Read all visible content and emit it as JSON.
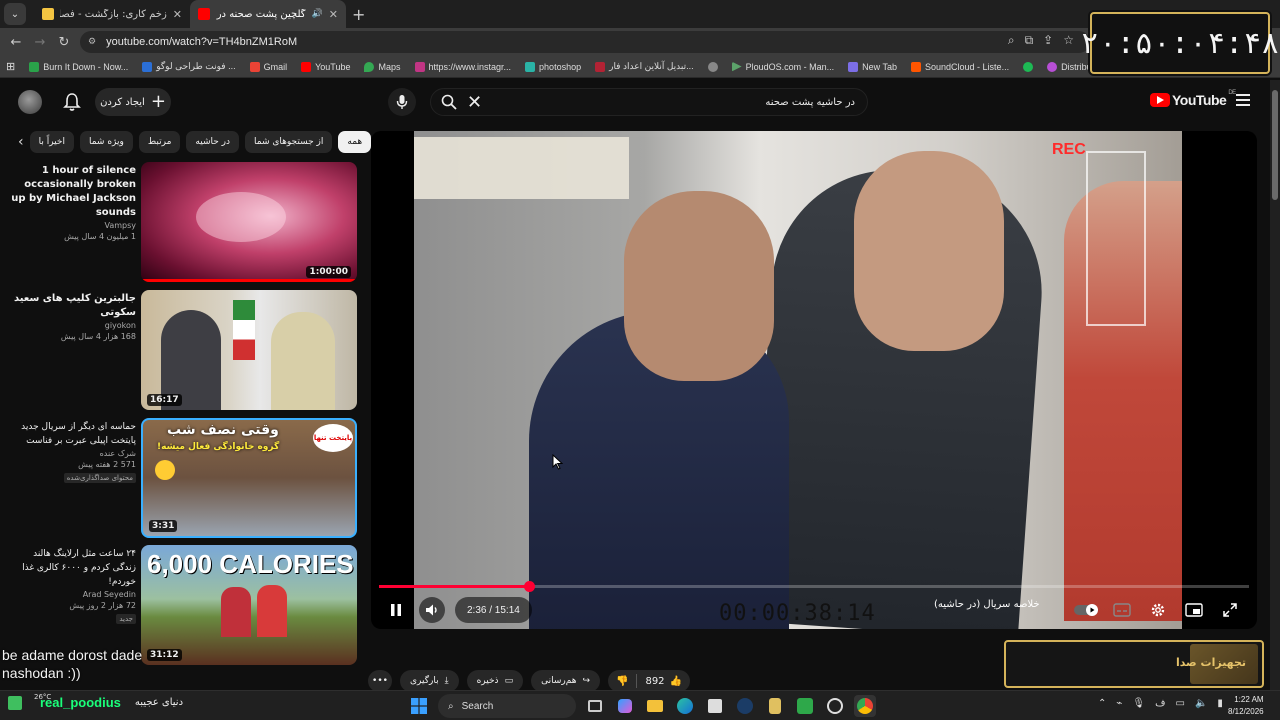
{
  "browser": {
    "tabs": [
      {
        "title": "زخم کاری: بازگشت - فصل 2 قسم...",
        "favicon_color": "#f4c542",
        "active": false
      },
      {
        "title": "گلچین پشت صحنه در حاشیه",
        "favicon_color": "#ff0000",
        "active": true
      }
    ],
    "url": "youtube.com/watch?v=TH4bnZM1RoM",
    "bookmarks": [
      {
        "label": "Burn It Down - Now...",
        "color": "#2aa24a"
      },
      {
        "label": "فونت طراحی لوگو ...",
        "color": "#2b6fd6"
      },
      {
        "label": "Gmail",
        "color": "#ea4335"
      },
      {
        "label": "YouTube",
        "color": "#ff0000"
      },
      {
        "label": "Maps",
        "color": "#34a853"
      },
      {
        "label": "https://www.instagr...",
        "color": "#c13584"
      },
      {
        "label": "photoshop",
        "color": "#2ab3a6"
      },
      {
        "label": "تبدیل آنلاین اعداد فار...",
        "color": "#b22234"
      },
      {
        "label": "",
        "color": "#888888"
      },
      {
        "label": "PloudOS.com - Man...",
        "color": "#5ca36a"
      },
      {
        "label": "New Tab",
        "color": "#7c6ee6"
      },
      {
        "label": "SoundCloud - Liste...",
        "color": "#ff5500"
      },
      {
        "label": "",
        "color": "#1db954"
      },
      {
        "label": "Distribution | Route...",
        "color": "#b84fd6"
      }
    ]
  },
  "overlay_clock": "۲۰:۵۰:۰۴:۴۸",
  "header": {
    "create_label": "ایجاد کردن",
    "search_query": "در حاشیه پشت صحنه",
    "logo_text": "YouTube",
    "logo_country": "DE"
  },
  "chips": [
    "همه",
    "از جستجوهای شما",
    "در حاشیه",
    "مرتبط",
    "ویژه شما",
    "اخیراً با"
  ],
  "recommendations": [
    {
      "title": "1 hour of silence occasionally broken up by Michael Jackson sounds",
      "channel": "Vampsy",
      "stats": "1 میلیون  4 سال پیش",
      "badge": "",
      "duration": "1:00:00",
      "thumb_style": "pink"
    },
    {
      "title": "جالبترین کلیپ های سعید سکوتی",
      "channel": "giyokon",
      "stats": "168 هزار  4 سال پیش",
      "badge": "",
      "duration": "16:17",
      "thumb_style": "news"
    },
    {
      "title": "حماسه ای دیگر از سریال جدید پایتخت اپیلی عبرت بر فناست",
      "channel": "شرک عنده",
      "stats": "571  2 هفته پیش",
      "badge": "محتوای صداگذاری‌شده",
      "duration": "3:31",
      "thumb_style": "comedy"
    },
    {
      "title": "۲۴ ساعت مثل ارلاینگ هالند زندگی کردم و ۶۰۰۰ کالری غذا خوردم!",
      "channel": "Arad Seyedin",
      "stats": "72 هزار  2 روز پیش",
      "badge": "جدید",
      "duration": "31:12",
      "thumb_style": "calories"
    }
  ],
  "thumb_text": {
    "comedy_headline": "وقتی نصف شب",
    "comedy_sub": "گروه خانوادگی فعال میشه!",
    "comedy_badge": "پایتخت تنها",
    "calories": "6,000 CALORIES"
  },
  "player": {
    "rec_label": "REC",
    "timecode": "00:00:38:14",
    "watermark": "خلاصه سریال (در حاشیه)",
    "time_display": "2:36 / 15:14",
    "progress_pct": 17.2
  },
  "actions": {
    "likes": "892",
    "share": "هم‌رسانی",
    "save": "ذخیره",
    "download": "بارگیری"
  },
  "sponsor_text": "تجهیزات صدا",
  "chat_lines": [
    "be adame dorost dade",
    "nashodan :))"
  ],
  "taskbar": {
    "temp": "26°C",
    "username": "real_poodius",
    "weather_desc": "دنیای عجیبه",
    "search_label": "Search",
    "time": "1:22 AM",
    "date": "8/12/2026"
  }
}
